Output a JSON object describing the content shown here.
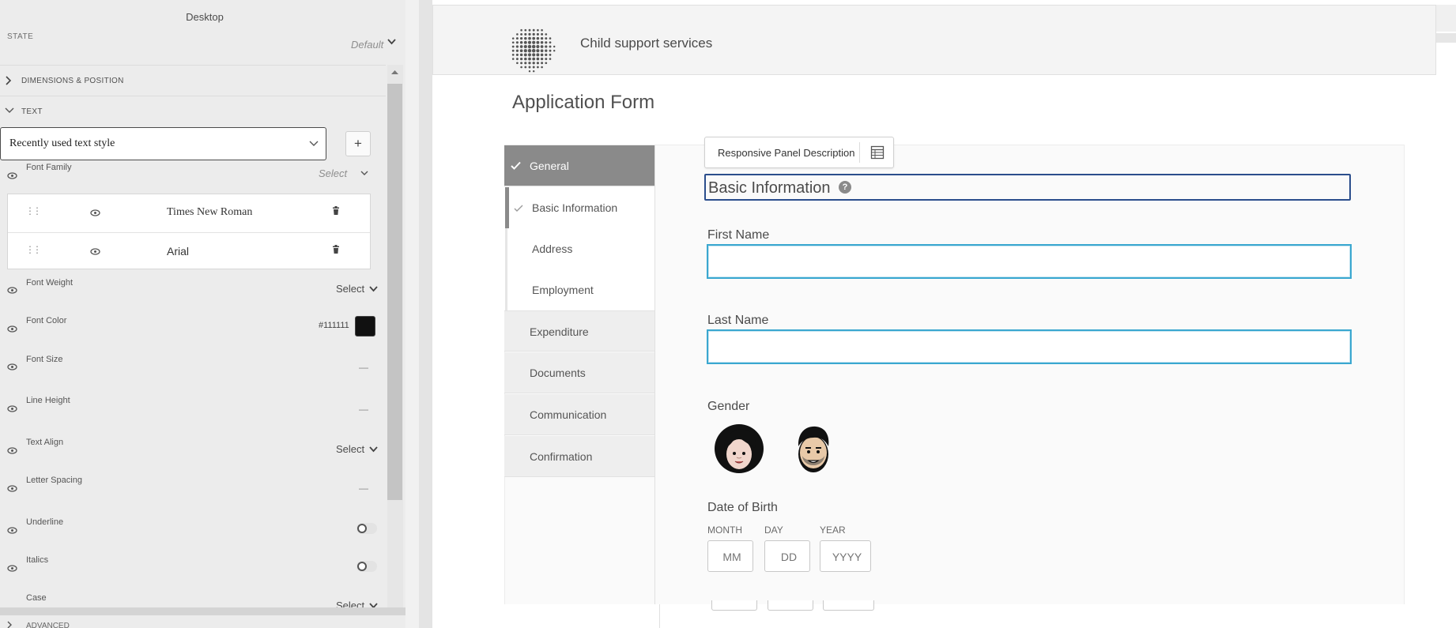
{
  "panel": {
    "title": "Desktop",
    "state_label": "STATE",
    "state_value": "Default",
    "sections": {
      "dimensions": "DIMENSIONS & POSITION",
      "text": "TEXT",
      "advanced": "ADVANCED"
    },
    "text_style_select": "Recently used text style",
    "add_style_button": "+",
    "font_family": {
      "label": "Font Family",
      "select_placeholder": "Select",
      "fonts": [
        "Times New Roman",
        "Arial"
      ]
    },
    "font_weight": {
      "label": "Font Weight",
      "value": "Select"
    },
    "font_color": {
      "label": "Font Color",
      "value": "#111111"
    },
    "font_size": {
      "label": "Font Size",
      "value": "—"
    },
    "line_height": {
      "label": "Line Height",
      "value": "—"
    },
    "text_align": {
      "label": "Text Align",
      "value": "Select"
    },
    "letter_spacing": {
      "label": "Letter Spacing",
      "value": "—"
    },
    "underline": {
      "label": "Underline",
      "on": false
    },
    "italics": {
      "label": "Italics",
      "on": false
    },
    "case": {
      "label": "Case",
      "value": "Select"
    }
  },
  "site": {
    "name": "Child support services"
  },
  "form": {
    "title": "Application Form",
    "nav": [
      {
        "label": "General",
        "active": true
      },
      {
        "label": "Basic Information",
        "sub": true,
        "current": true
      },
      {
        "label": "Address",
        "sub": true
      },
      {
        "label": "Employment",
        "sub": true
      },
      {
        "label": "Expenditure"
      },
      {
        "label": "Documents"
      },
      {
        "label": "Communication"
      },
      {
        "label": "Confirmation"
      }
    ],
    "toolbar_label": "Responsive Panel Description",
    "section_heading": "Basic Information",
    "help_icon": "?",
    "first_name_label": "First Name",
    "last_name_label": "Last Name",
    "gender_label": "Gender",
    "dob_label": "Date of Birth",
    "dob": {
      "month_label": "MONTH",
      "month_placeholder": "MM",
      "day_label": "DAY",
      "day_placeholder": "DD",
      "year_label": "YEAR",
      "year_placeholder": "YYYY"
    }
  },
  "colors": {
    "active_nav": "#8a8a8a",
    "focus_border": "#2b4e8c",
    "input_border": "#3aa7d0",
    "swatch": "#111111"
  },
  "icons": [
    "chevron-down-icon",
    "chevron-right-icon",
    "eye-icon",
    "drag-handle-icon",
    "trash-icon",
    "check-icon",
    "table-icon",
    "help-icon",
    "female-avatar-icon",
    "male-avatar-icon",
    "dotted-sphere-logo"
  ]
}
